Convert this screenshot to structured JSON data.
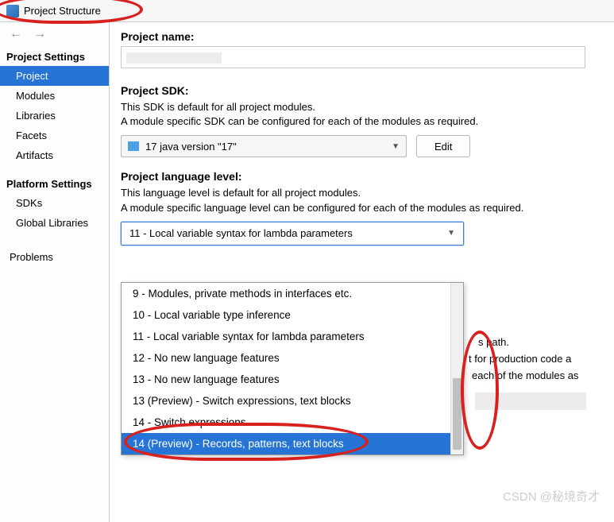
{
  "title": "Project Structure",
  "sidebar": {
    "group1_header": "Project Settings",
    "group1": [
      "Project",
      "Modules",
      "Libraries",
      "Facets",
      "Artifacts"
    ],
    "group2_header": "Platform Settings",
    "group2": [
      "SDKs",
      "Global Libraries"
    ],
    "group3": [
      "Problems"
    ]
  },
  "main": {
    "projectNameLabel": "Project name:",
    "sdkLabel": "Project SDK:",
    "sdkDesc1": "This SDK is default for all project modules.",
    "sdkDesc2": "A module specific SDK can be configured for each of the modules as required.",
    "sdkValue": "17 java version \"17\"",
    "editBtn": "Edit",
    "langLabel": "Project language level:",
    "langDesc1": "This language level is default for all project modules.",
    "langDesc2": "A module specific language level can be configured for each of the modules as required.",
    "langValue": "11 - Local variable syntax for lambda parameters",
    "bgText1": "s path.",
    "bgText2": "t for production code a",
    "bgText3": "each of the modules as"
  },
  "dropdown": {
    "options": [
      "9 - Modules, private methods in interfaces etc.",
      "10 - Local variable type inference",
      "11 - Local variable syntax for lambda parameters",
      "12 - No new language features",
      "13 - No new language features",
      "13 (Preview) - Switch expressions, text blocks",
      "14 - Switch expressions",
      "14 (Preview) - Records, patterns, text blocks"
    ],
    "highlightIndex": 7
  },
  "watermark": "CSDN @秘境奇才"
}
